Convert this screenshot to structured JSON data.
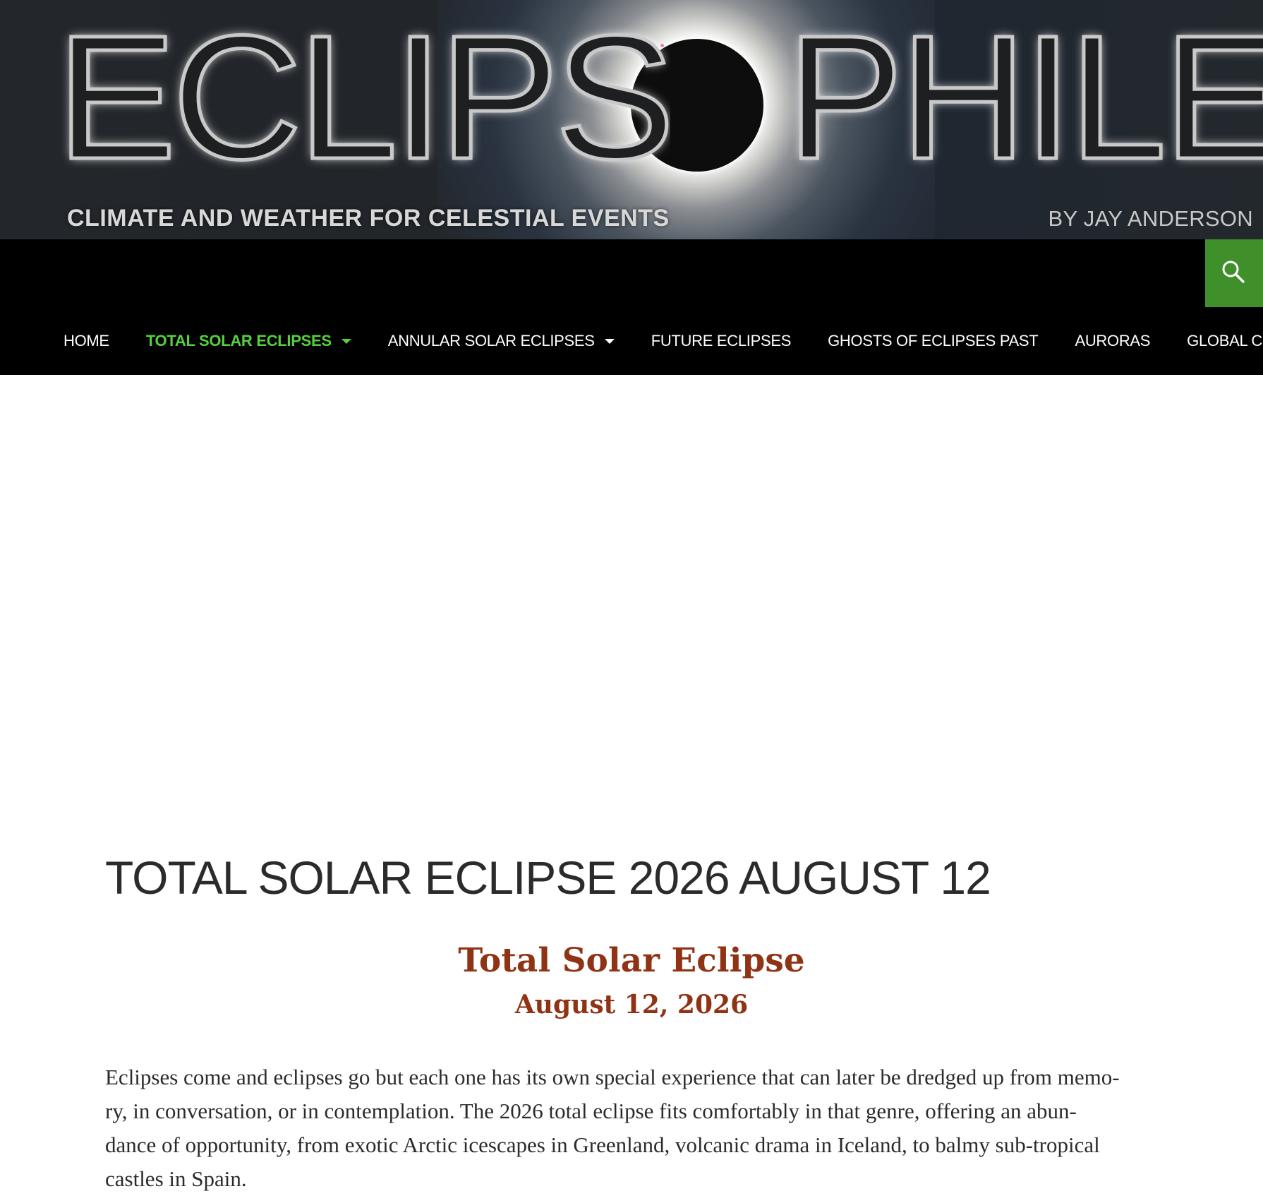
{
  "banner": {
    "logo_left": "ECLIPS",
    "logo_right": "PHILE",
    "tagline": "CLIMATE AND WEATHER FOR CELESTIAL EVENTS",
    "byline": "BY JAY ANDERSON"
  },
  "nav": {
    "search_icon": "search-icon",
    "items": [
      {
        "label": "Home",
        "has_dropdown": false,
        "active": false
      },
      {
        "label": "Total Solar Eclipses",
        "has_dropdown": true,
        "active": true
      },
      {
        "label": "Annular Solar Eclipses",
        "has_dropdown": true,
        "active": false
      },
      {
        "label": "Future Eclipses",
        "has_dropdown": false,
        "active": false
      },
      {
        "label": "Ghosts of Eclipses Past",
        "has_dropdown": false,
        "active": false
      },
      {
        "label": "Auroras",
        "has_dropdown": false,
        "active": false
      },
      {
        "label": "Global Cloud",
        "has_dropdown": false,
        "active": false
      }
    ]
  },
  "article": {
    "title": "TOTAL SOLAR ECLIPSE 2026 AUGUST 12",
    "heading": "Total Solar Eclipse",
    "date": "August 12, 2026",
    "intro_lines": [
      "Eclipses come and eclipses go but each one has its own special experience that can later be dredged up from memo-",
      "ry, in conversation, or in contemplation. The 2026 total eclipse fits comfortably in that genre, offering an abun-",
      "dance of opportunity, from exotic Arctic icescapes in Greenland, volcanic drama in Iceland, to balmy sub-tropical",
      "castles in Spain."
    ]
  },
  "colors": {
    "nav_background": "#000000",
    "nav_active": "#55d13e",
    "search_button": "#3f8f2b",
    "heading_accent": "#8f3314",
    "body_text": "#2b2b2b"
  }
}
